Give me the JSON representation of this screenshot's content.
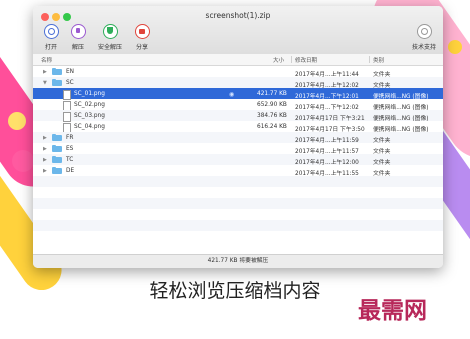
{
  "colors": {
    "selection": "#2f69d8",
    "folder": "#6cb7ea",
    "watermark": "#b7285a"
  },
  "window": {
    "title": "screenshot(1).zip"
  },
  "toolbar": {
    "open": {
      "label": "打开",
      "icon": "open-icon"
    },
    "extract": {
      "label": "解压",
      "icon": "extract-icon"
    },
    "safe_extract": {
      "label": "安全解压",
      "icon": "safe-extract-icon"
    },
    "share": {
      "label": "分享",
      "icon": "share-icon"
    },
    "support": {
      "label": "技术支持",
      "icon": "support-icon"
    }
  },
  "columns": {
    "name": "名称",
    "size": "大小",
    "modified": "修改日期",
    "kind": "类别"
  },
  "rows": [
    {
      "name": "EN",
      "size": "",
      "modified": "2017年4月...上午11:44",
      "kind": "文件夹"
    },
    {
      "name": "SC",
      "size": "",
      "modified": "2017年4月...上午12:02",
      "kind": "文件夹"
    },
    {
      "name": "SC_01.png",
      "size": "421.77 KB",
      "modified": "2017年4月...下午12:01",
      "kind": "便携网络...NG (图像)"
    },
    {
      "name": "SC_02.png",
      "size": "652.90 KB",
      "modified": "2017年4月...下午12:02",
      "kind": "便携网络...NG (图像)"
    },
    {
      "name": "SC_03.png",
      "size": "384.76 KB",
      "modified": "2017年4月17日 下午3:21",
      "kind": "便携网络...NG (图像)"
    },
    {
      "name": "SC_04.png",
      "size": "616.24 KB",
      "modified": "2017年4月17日 下午3:50",
      "kind": "便携网络...NG (图像)"
    },
    {
      "name": "FR",
      "size": "",
      "modified": "2017年4月...上午11:59",
      "kind": "文件夹"
    },
    {
      "name": "ES",
      "size": "",
      "modified": "2017年4月...上午11:57",
      "kind": "文件夹"
    },
    {
      "name": "TC",
      "size": "",
      "modified": "2017年4月...上午12:00",
      "kind": "文件夹"
    },
    {
      "name": "DE",
      "size": "",
      "modified": "2017年4月...上午11:55",
      "kind": "文件夹"
    }
  ],
  "status": "421.77 KB 将要被解压",
  "caption": "轻松浏览压缩档内容",
  "watermark": "最需网"
}
